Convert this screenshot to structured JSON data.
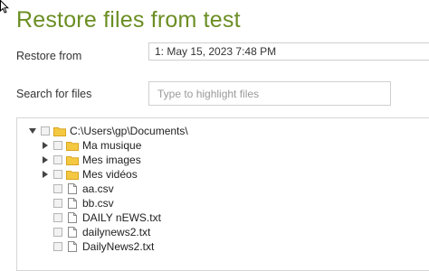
{
  "cursor_icon": "mouse-pointer-icon",
  "dialog": {
    "title": "Restore files from test",
    "restore_from_label": "Restore from",
    "restore_from_value": "1: May 15, 2023 7:48 PM",
    "search_label": "Search for files",
    "search_placeholder": "Type to highlight files"
  },
  "tree": {
    "root": {
      "label": "C:\\Users\\gp\\Documents\\",
      "expanded": true,
      "icon": "folder-icon"
    },
    "children": [
      {
        "label": "Ma musique",
        "type": "folder",
        "expandable": true
      },
      {
        "label": "Mes images",
        "type": "folder",
        "expandable": true
      },
      {
        "label": "Mes vidéos",
        "type": "folder",
        "expandable": true
      },
      {
        "label": "aa.csv",
        "type": "file",
        "expandable": false
      },
      {
        "label": "bb.csv",
        "type": "file",
        "expandable": false
      },
      {
        "label": "DAILY nEWS.txt",
        "type": "file",
        "expandable": false
      },
      {
        "label": "dailynews2.txt",
        "type": "file",
        "expandable": false
      },
      {
        "label": "DailyNews2.txt",
        "type": "file",
        "expandable": false
      }
    ]
  },
  "colors": {
    "title": "#6b8e23",
    "folder": "#f5c842",
    "border": "#cfcfcf"
  }
}
